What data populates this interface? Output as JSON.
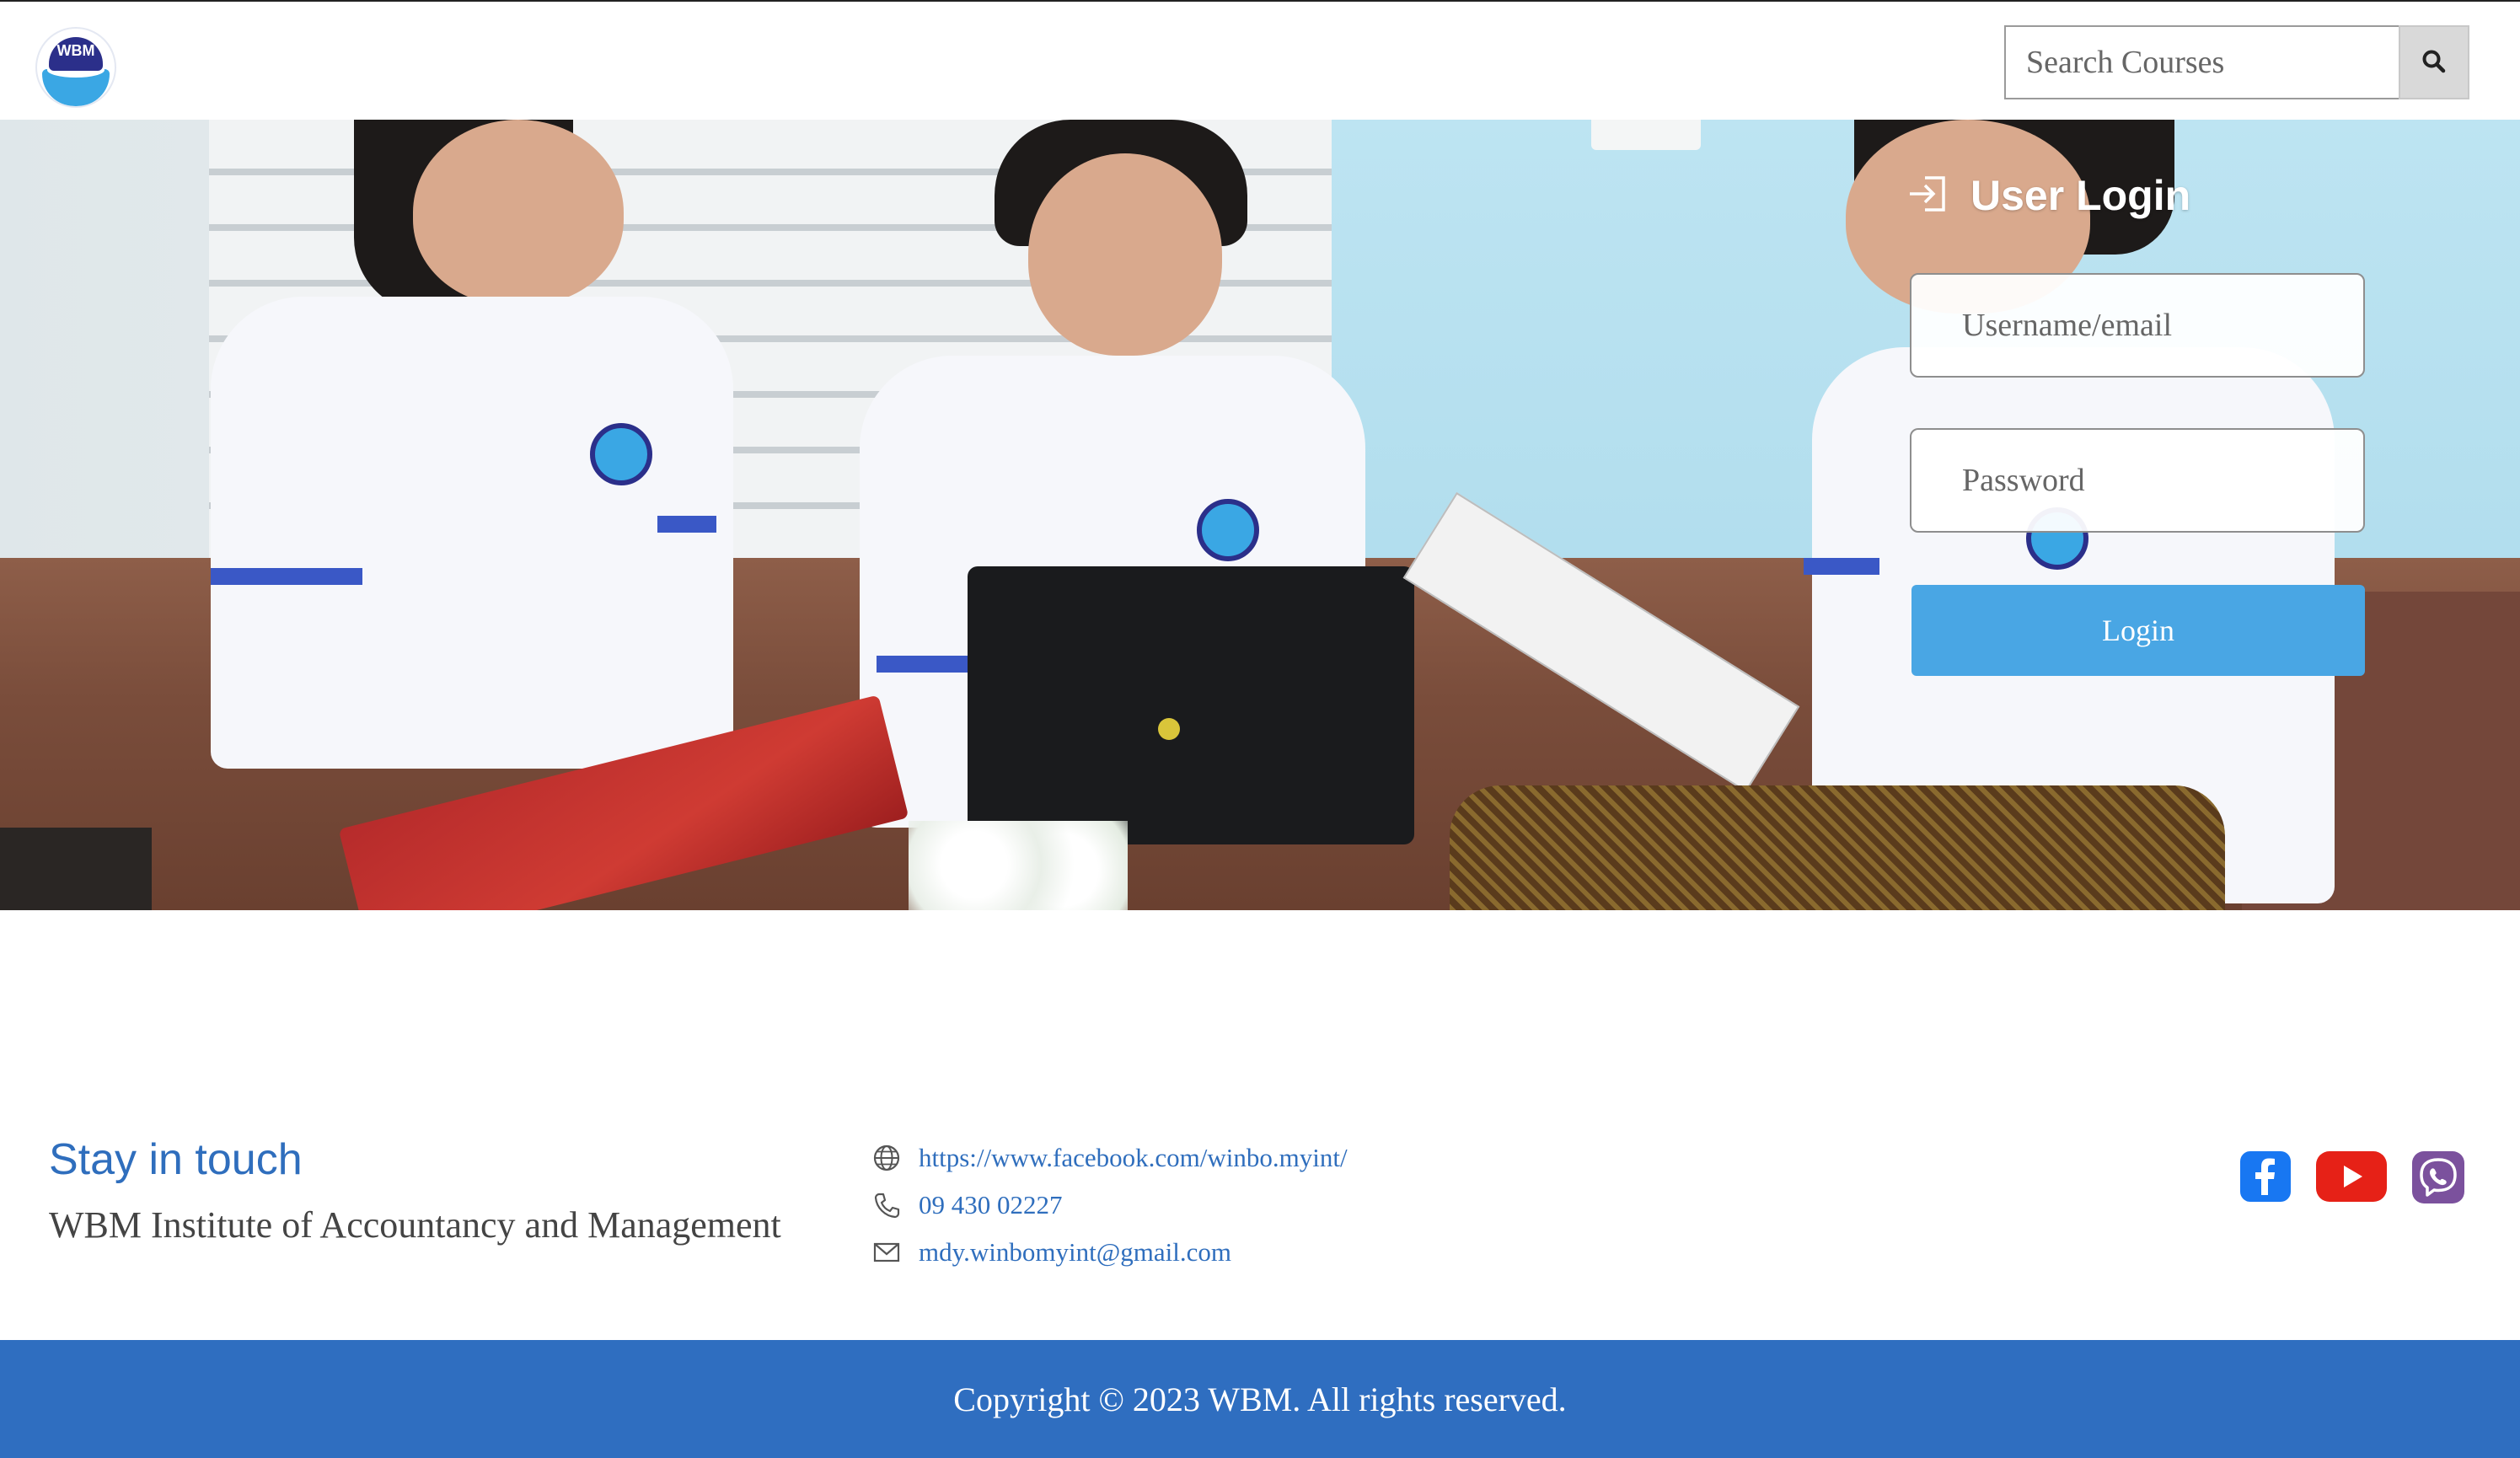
{
  "header": {
    "logo_text": "WBM",
    "search": {
      "placeholder": "Search Courses",
      "value": ""
    },
    "search_icon": "search-icon"
  },
  "hero": {
    "image_desc_icon": "hero-photo"
  },
  "login": {
    "title": "User Login",
    "title_icon": "sign-in-icon",
    "username_placeholder": "Username/email",
    "password_placeholder": "Password",
    "button_label": "Login"
  },
  "footer": {
    "stay_title": "Stay in touch",
    "org_name": "WBM Institute of Accountancy and Management",
    "contacts": [
      {
        "icon": "globe-icon",
        "text": "https://www.facebook.com/winbo.myint/"
      },
      {
        "icon": "phone-icon",
        "text": "09 430 02227"
      },
      {
        "icon": "mail-icon",
        "text": "mdy.winbomyint@gmail.com"
      }
    ],
    "social": [
      {
        "icon": "facebook-icon",
        "color": "#1877f2"
      },
      {
        "icon": "youtube-icon",
        "color": "#e62117"
      },
      {
        "icon": "viber-icon",
        "color": "#7b519d"
      }
    ],
    "copyright": "Copyright © 2023 WBM. All rights reserved."
  },
  "colors": {
    "accent_blue": "#2f6ebd",
    "login_button": "#49a6e4",
    "copyright_bar": "#2f6ec0"
  }
}
